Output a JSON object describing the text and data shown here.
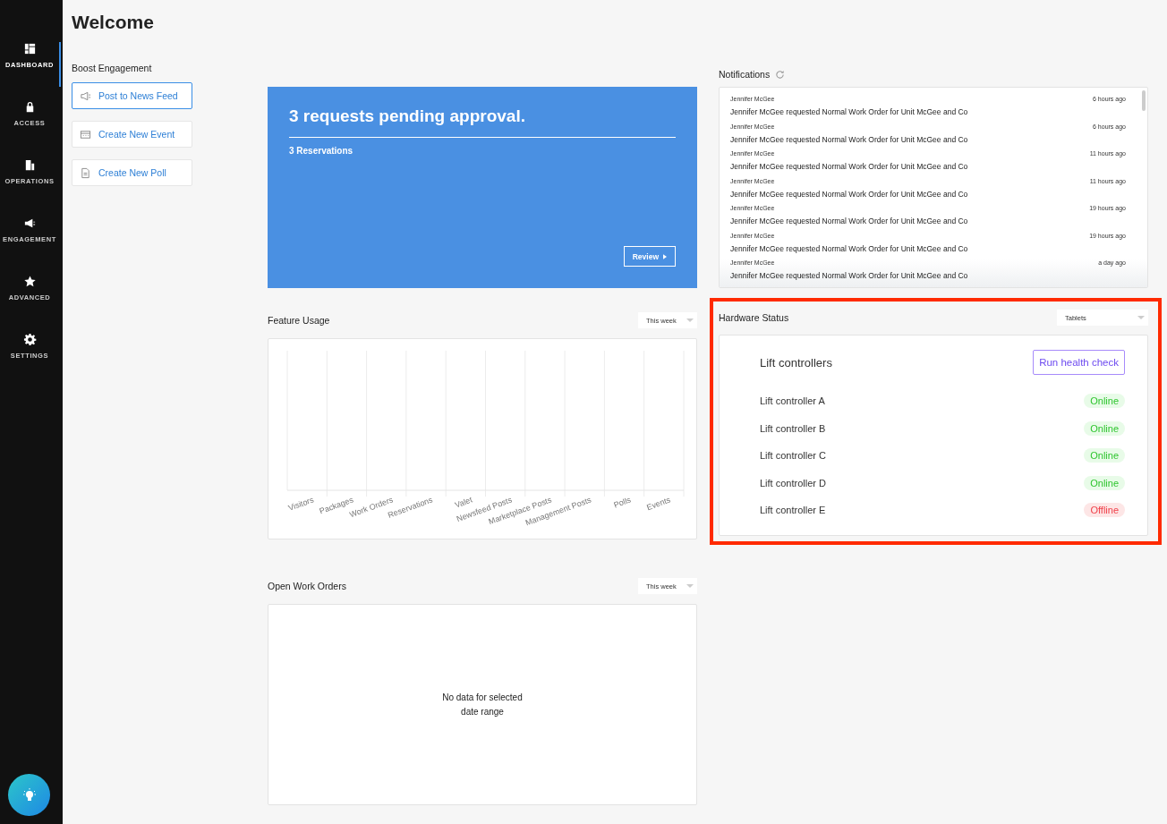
{
  "sidebar": {
    "items": [
      {
        "label": "DASHBOARD",
        "kind": "dashboard",
        "selected": true
      },
      {
        "label": "ACCESS",
        "kind": "lock",
        "selected": false
      },
      {
        "label": "OPERATIONS",
        "kind": "building",
        "selected": false
      },
      {
        "label": "ENGAGEMENT",
        "kind": "megaphone",
        "selected": false
      },
      {
        "label": "ADVANCED",
        "kind": "star",
        "selected": false
      },
      {
        "label": "SETTINGS",
        "kind": "gear",
        "selected": false
      }
    ]
  },
  "page_title": "Welcome",
  "boost_engagement": {
    "title": "Boost Engagement",
    "actions": [
      {
        "label": "Post to News Feed",
        "kind": "megaphone",
        "selected": true
      },
      {
        "label": "Create New Event",
        "kind": "calendar",
        "selected": false
      },
      {
        "label": "Create New Poll",
        "kind": "document",
        "selected": false
      }
    ]
  },
  "pending_card": {
    "title": "3 requests pending approval.",
    "subtitle": "3 Reservations",
    "button": "Review"
  },
  "feature_usage": {
    "title": "Feature Usage",
    "range": "This week",
    "categories": [
      "Visitors",
      "Packages",
      "Work Orders",
      "Reservations",
      "Valet",
      "Newsfeed Posts",
      "Marketplace Posts",
      "Management Posts",
      "Polls",
      "Events"
    ]
  },
  "open_work_orders": {
    "title": "Open Work Orders",
    "range": "This week",
    "empty_message": "No data for selected date range"
  },
  "notifications": {
    "title": "Notifications",
    "items": [
      {
        "author": "Jennifer McGee",
        "time": "6 hours ago",
        "message": "Jennifer McGee requested Normal Work Order for Unit McGee and Co"
      },
      {
        "author": "Jennifer McGee",
        "time": "6 hours ago",
        "message": "Jennifer McGee requested Normal Work Order for Unit McGee and Co"
      },
      {
        "author": "Jennifer McGee",
        "time": "11 hours ago",
        "message": "Jennifer McGee requested Normal Work Order for Unit McGee and Co"
      },
      {
        "author": "Jennifer McGee",
        "time": "11 hours ago",
        "message": "Jennifer McGee requested Normal Work Order for Unit McGee and Co"
      },
      {
        "author": "Jennifer McGee",
        "time": "19 hours ago",
        "message": "Jennifer McGee requested Normal Work Order for Unit McGee and Co"
      },
      {
        "author": "Jennifer McGee",
        "time": "19 hours ago",
        "message": "Jennifer McGee requested Normal Work Order for Unit McGee and Co"
      },
      {
        "author": "Jennifer McGee",
        "time": "a day ago",
        "message": "Jennifer McGee requested Normal Work Order for Unit McGee and Co"
      }
    ]
  },
  "hardware_status": {
    "title": "Hardware Status",
    "highlighted": true,
    "device_type": "Tablets",
    "group_title": "Lift controllers",
    "button": "Run health check",
    "devices": [
      {
        "name": "Lift controller A",
        "status": "Online",
        "kind": "online"
      },
      {
        "name": "Lift controller B",
        "status": "Online",
        "kind": "online"
      },
      {
        "name": "Lift controller C",
        "status": "Online",
        "kind": "online"
      },
      {
        "name": "Lift controller D",
        "status": "Online",
        "kind": "online"
      },
      {
        "name": "Lift controller E",
        "status": "Offline",
        "kind": "offline"
      }
    ]
  }
}
